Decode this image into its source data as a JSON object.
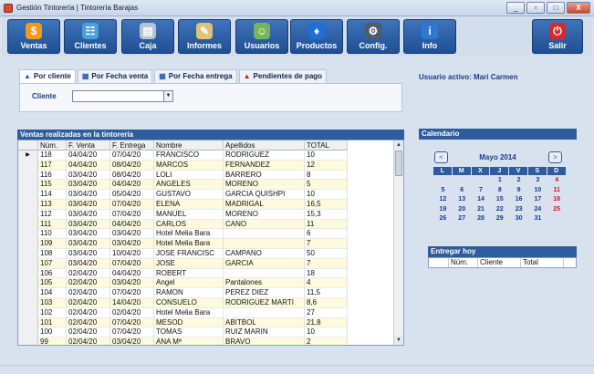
{
  "window": {
    "title": "Gestión Tintorería | Tintorería Barajas",
    "min": "_",
    "max": "□",
    "restore": "▫",
    "close": "X"
  },
  "toolbar": {
    "items": [
      {
        "label": "Ventas",
        "icon": "coin-icon",
        "glyph": "$",
        "color": "#f29a1c"
      },
      {
        "label": "Clientes",
        "icon": "clients-icon",
        "glyph": "☷",
        "color": "#4aa0d8"
      },
      {
        "label": "Caja",
        "icon": "cash-register-icon",
        "glyph": "▤",
        "color": "#b7c3d2"
      },
      {
        "label": "Informes",
        "icon": "report-icon",
        "glyph": "✎",
        "color": "#e2c27a"
      },
      {
        "label": "Usuarios",
        "icon": "users-icon",
        "glyph": "☺",
        "color": "#78b45a"
      },
      {
        "label": "Productos",
        "icon": "shirt-icon",
        "glyph": "♦",
        "color": "#1e6fd8"
      },
      {
        "label": "Config.",
        "icon": "gear-icon",
        "glyph": "⚙",
        "color": "#4f5b6b"
      },
      {
        "label": "Info",
        "icon": "info-icon",
        "glyph": "i",
        "color": "#2f78d0"
      },
      {
        "label": "Salir",
        "icon": "power-icon",
        "glyph": "⏻",
        "color": "#d32b2b"
      }
    ]
  },
  "tabs": [
    {
      "label": "Por cliente",
      "icon": "user-filter-icon",
      "glyph": "▲",
      "active": true
    },
    {
      "label": "Por Fecha venta",
      "icon": "calendar-filter-icon",
      "glyph": "▦",
      "active": false
    },
    {
      "label": "Por Fecha entrega",
      "icon": "calendar-filter-icon",
      "glyph": "▦",
      "active": false
    },
    {
      "label": "Pendientes de pago",
      "icon": "warning-icon",
      "glyph": "▲",
      "active": false
    }
  ],
  "filter": {
    "cliente_label": "Cliente",
    "cliente_value": ""
  },
  "user_active": "Usuario activo: Mari Carmen",
  "sales": {
    "title": "Ventas realizadas en la tintorería",
    "columns": [
      "Núm.",
      "F. Venta",
      "F. Entrega",
      "Nombre",
      "Apellidos",
      "TOTAL"
    ],
    "rows": [
      [
        "118",
        "04/04/20",
        "07/04/20",
        "FRANCISCO",
        "RODRIGUEZ",
        "10"
      ],
      [
        "117",
        "04/04/20",
        "08/04/20",
        "MARCOS",
        "FERNANDEZ",
        "12"
      ],
      [
        "116",
        "03/04/20",
        "08/04/20",
        "LOLI",
        "BARRERO",
        "8"
      ],
      [
        "115",
        "03/04/20",
        "04/04/20",
        "ANGELES",
        "MORENO",
        "5"
      ],
      [
        "114",
        "03/04/20",
        "05/04/20",
        "GUSTAVO",
        "GARCIA  QUISHPI",
        "10"
      ],
      [
        "113",
        "03/04/20",
        "07/04/20",
        "ELENA",
        "MADRIGAL",
        "16,5"
      ],
      [
        "112",
        "03/04/20",
        "07/04/20",
        "MANUEL",
        "MORENO",
        "15,3"
      ],
      [
        "111",
        "03/04/20",
        "04/04/20",
        "CARLOS",
        "CANO",
        "11"
      ],
      [
        "110",
        "03/04/20",
        "03/04/20",
        "Hotel Melia Bara",
        "",
        "6"
      ],
      [
        "109",
        "03/04/20",
        "03/04/20",
        "Hotel Melia Bara",
        "",
        "7"
      ],
      [
        "108",
        "03/04/20",
        "10/04/20",
        "JOSE FRANCISC",
        "CAMPANO",
        "50"
      ],
      [
        "107",
        "03/04/20",
        "07/04/20",
        "JOSE",
        "GARCIA",
        "7"
      ],
      [
        "106",
        "02/04/20",
        "04/04/20",
        "ROBERT",
        "",
        "18"
      ],
      [
        "105",
        "02/04/20",
        "03/04/20",
        "Angel",
        "Pantalones",
        "4"
      ],
      [
        "104",
        "02/04/20",
        "07/04/20",
        "RAMON",
        "PEREZ DIEZ",
        "11,5"
      ],
      [
        "103",
        "02/04/20",
        "14/04/20",
        "CONSUELO",
        "RODRIGUEZ MARTI",
        "8,6"
      ],
      [
        "102",
        "02/04/20",
        "02/04/20",
        "Hotel Melia Bara",
        "",
        "27"
      ],
      [
        "101",
        "02/04/20",
        "07/04/20",
        "MESOD",
        "ABITBOL",
        "21,8"
      ],
      [
        "100",
        "02/04/20",
        "07/04/20",
        "TOMAS",
        "RUIZ MARIN",
        "10"
      ],
      [
        "99",
        "02/04/20",
        "03/04/20",
        "ANA Mª",
        "BRAVO",
        "2"
      ]
    ],
    "current_row_marker": "▶"
  },
  "calendar": {
    "title": "Calendario",
    "month_label": "Mayo 2014",
    "prev": "<",
    "next": ">",
    "weekdays": [
      "L",
      "M",
      "X",
      "J",
      "V",
      "S",
      "D"
    ],
    "weeks": [
      [
        "",
        "",
        "",
        "1",
        "2",
        "3",
        "4"
      ],
      [
        "5",
        "6",
        "7",
        "8",
        "9",
        "10",
        "11"
      ],
      [
        "12",
        "13",
        "14",
        "15",
        "16",
        "17",
        "18"
      ],
      [
        "19",
        "20",
        "21",
        "22",
        "23",
        "24",
        "25"
      ],
      [
        "26",
        "27",
        "28",
        "29",
        "30",
        "31",
        ""
      ]
    ]
  },
  "entregar": {
    "title": "Entregar hoy",
    "columns": [
      "Núm.",
      "Cliente",
      "Total"
    ]
  },
  "scrollbar": {
    "up": "▲",
    "down": "▼"
  },
  "combo_arrow": "▼"
}
